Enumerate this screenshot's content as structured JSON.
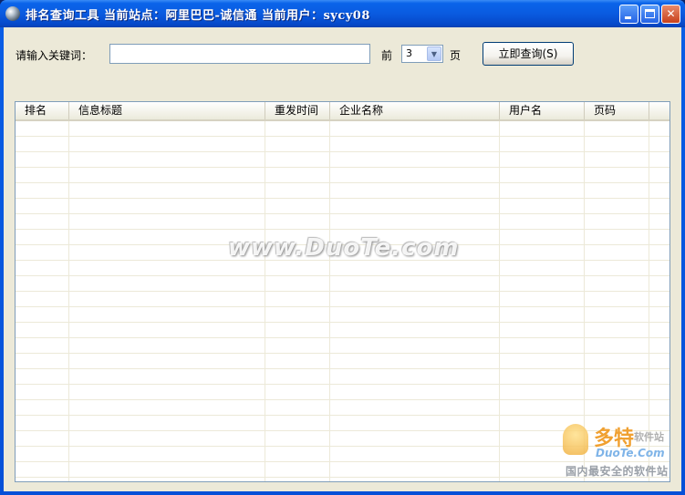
{
  "window": {
    "title": "排名查询工具  当前站点：阿里巴巴-诚信通  当前用户：sycy08",
    "minimize_icon": "minimize-icon",
    "maximize_icon": "maximize-icon",
    "close_label": "✕"
  },
  "form": {
    "keyword_label": "请输入关键词：",
    "keyword_value": "",
    "prefix_label": "前",
    "pages_value": "3",
    "suffix_label": "页",
    "query_button": "立即查询(S)"
  },
  "table": {
    "columns": [
      "排名",
      "信息标题",
      "重发时间",
      "企业名称",
      "用户名",
      "页码"
    ],
    "rows": []
  },
  "watermarks": {
    "center": "www.DuoTe.com",
    "logo_big": "多特",
    "logo_small": "软件站",
    "logo_url": "DuoTe.Com",
    "logo_slogan": "国内最安全的软件站"
  },
  "colors": {
    "titlebar": "#0a5be0",
    "client_bg": "#ece9d8",
    "border": "#7f9db9"
  }
}
